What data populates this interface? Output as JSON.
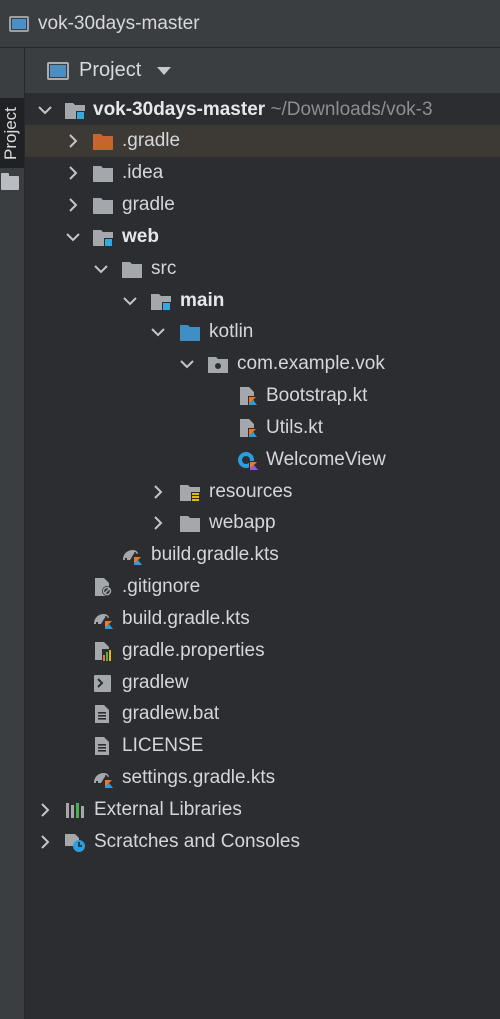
{
  "window": {
    "title": "vok-30days-master"
  },
  "tool_stripe": {
    "tab_label": "Project"
  },
  "panel": {
    "title": "Project"
  },
  "tree": {
    "root": {
      "label": "vok-30days-master",
      "path_hint": "~/Downloads/vok-3"
    },
    "gradle_hidden": ".gradle",
    "idea": ".idea",
    "gradle": "gradle",
    "web": "web",
    "src": "src",
    "main": "main",
    "kotlin": "kotlin",
    "package": "com.example.vok",
    "bootstrap": "Bootstrap.kt",
    "utils": "Utils.kt",
    "welcome": "WelcomeView",
    "resources": "resources",
    "webapp": "webapp",
    "web_build": "build.gradle.kts",
    "gitignore": ".gitignore",
    "root_build": "build.gradle.kts",
    "gradle_properties": "gradle.properties",
    "gradlew": "gradlew",
    "gradlew_bat": "gradlew.bat",
    "license": "LICENSE",
    "settings": "settings.gradle.kts",
    "external_libraries": "External Libraries",
    "scratches": "Scratches and Consoles"
  },
  "colors": {
    "folder_gray": "#a4a8ad",
    "folder_blue": "#3d8fc4",
    "folder_orange": "#c8652e",
    "kotlin_orange": "#e77a2a",
    "kotlin_blue": "#2a9ee0"
  }
}
